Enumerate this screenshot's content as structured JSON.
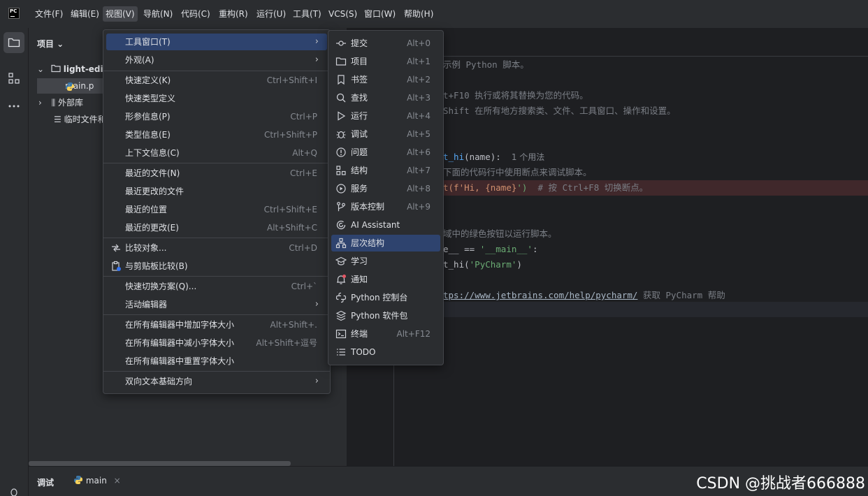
{
  "menubar": {
    "items": [
      "文件(F)",
      "编辑(E)",
      "视图(V)",
      "导航(N)",
      "代码(C)",
      "重构(R)",
      "运行(U)",
      "工具(T)",
      "VCS(S)",
      "窗口(W)",
      "帮助(H)"
    ]
  },
  "project": {
    "title": "项目 ⌄",
    "tree": [
      {
        "label": "light-edi"
      },
      {
        "label": "main.p"
      },
      {
        "label": "外部库"
      },
      {
        "label": "临时文件和"
      }
    ]
  },
  "view_menu": {
    "items": [
      {
        "label": "工具窗口(T)",
        "shortcut": "",
        "submenu": true
      },
      {
        "label": "外观(A)",
        "shortcut": "",
        "submenu": true
      },
      {
        "label": "快速定义(K)",
        "shortcut": "Ctrl+Shift+I"
      },
      {
        "label": "快速类型定义",
        "shortcut": ""
      },
      {
        "label": "形参信息(P)",
        "shortcut": "Ctrl+P"
      },
      {
        "label": "类型信息(E)",
        "shortcut": "Ctrl+Shift+P"
      },
      {
        "label": "上下文信息(C)",
        "shortcut": "Alt+Q"
      },
      {
        "label": "最近的文件(N)",
        "shortcut": "Ctrl+E"
      },
      {
        "label": "最近更改的文件",
        "shortcut": ""
      },
      {
        "label": "最近的位置",
        "shortcut": "Ctrl+Shift+E"
      },
      {
        "label": "最近的更改(E)",
        "shortcut": "Alt+Shift+C"
      },
      {
        "label": "比较对象...",
        "shortcut": "Ctrl+D"
      },
      {
        "label": "与剪贴板比较(B)",
        "shortcut": ""
      },
      {
        "label": "快速切换方案(Q)...",
        "shortcut": "Ctrl+`"
      },
      {
        "label": "活动编辑器",
        "shortcut": "",
        "submenu": true
      },
      {
        "label": "在所有编辑器中增加字体大小",
        "shortcut": "Alt+Shift+."
      },
      {
        "label": "在所有编辑器中减小字体大小",
        "shortcut": "Alt+Shift+逗号"
      },
      {
        "label": "在所有编辑器中重置字体大小",
        "shortcut": ""
      },
      {
        "label": "双向文本基础方向",
        "shortcut": "",
        "submenu": true
      }
    ]
  },
  "tool_menu": {
    "items": [
      {
        "label": "提交",
        "shortcut": "Alt+0",
        "icon": "commit-icon"
      },
      {
        "label": "项目",
        "shortcut": "Alt+1",
        "icon": "folder-icon"
      },
      {
        "label": "书签",
        "shortcut": "Alt+2",
        "icon": "bookmark-icon"
      },
      {
        "label": "查找",
        "shortcut": "Alt+3",
        "icon": "search-icon"
      },
      {
        "label": "运行",
        "shortcut": "Alt+4",
        "icon": "run-icon"
      },
      {
        "label": "调试",
        "shortcut": "Alt+5",
        "icon": "debug-icon"
      },
      {
        "label": "问题",
        "shortcut": "Alt+6",
        "icon": "problems-icon"
      },
      {
        "label": "结构",
        "shortcut": "Alt+7",
        "icon": "structure-icon"
      },
      {
        "label": "服务",
        "shortcut": "Alt+8",
        "icon": "services-icon"
      },
      {
        "label": "版本控制",
        "shortcut": "Alt+9",
        "icon": "vcs-icon"
      },
      {
        "label": "AI Assistant",
        "shortcut": "",
        "icon": "ai-assistant-icon"
      },
      {
        "label": "层次结构",
        "shortcut": "",
        "icon": "hierarchy-icon"
      },
      {
        "label": "学习",
        "shortcut": "",
        "icon": "learn-icon"
      },
      {
        "label": "通知",
        "shortcut": "",
        "icon": "notification-icon"
      },
      {
        "label": "Python 控制台",
        "shortcut": "",
        "icon": "python-console-icon"
      },
      {
        "label": "Python 软件包",
        "shortcut": "",
        "icon": "packages-icon"
      },
      {
        "label": "终端",
        "shortcut": "Alt+F12",
        "icon": "terminal-icon"
      },
      {
        "label": "TODO",
        "shortcut": "",
        "icon": "todo-icon"
      }
    ]
  },
  "editor": {
    "line1": "示例 Python 脚本。",
    "line2": "t+F10 执行或将其替换为您的代码。",
    "line3": "Shift 在所有地方搜索类、文件、工具窗口、操作和设置。",
    "line4_fn": "t_hi",
    "line4_rest": "(name):",
    "line4_hint": "1 个用法",
    "line5": "下面的代码行中使用断点来调试脚本。",
    "line6_a": "t(f'Hi, ",
    "line6_b": "{name}",
    "line6_c": "')",
    "line6_cm": "  # 按 Ctrl+F8 切换断点。",
    "line7": "域中的绿色按钮以运行脚本。",
    "line8_a": "e__ == ",
    "line8_b": "'__main__'",
    "line8_c": ":",
    "line9_a": "t_hi(",
    "line9_b": "'PyCharm'",
    "line9_c": ")",
    "line10_link": "tps://www.jetbrains.com/help/pycharm/",
    "line10_rest": " 获取 PyCharm 帮助"
  },
  "bottombar": {
    "debug_label": "调试",
    "tab_label": "main",
    "close": "×"
  },
  "watermark": "CSDN @挑战者666888"
}
